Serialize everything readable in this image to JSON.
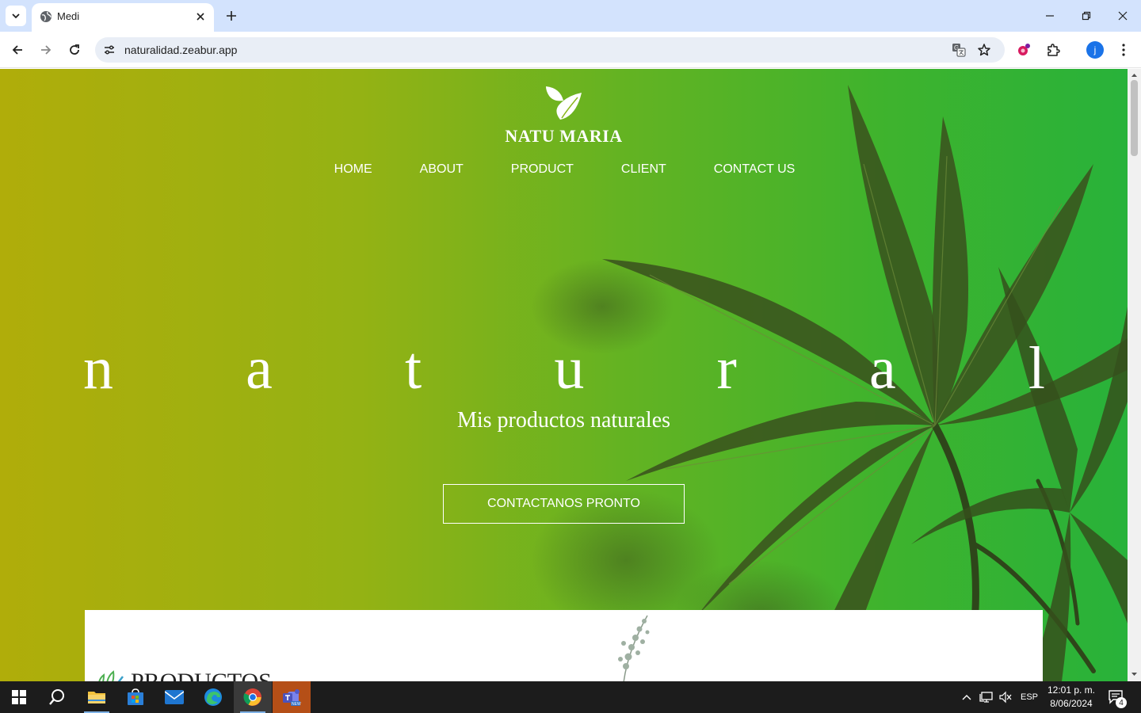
{
  "browser": {
    "tab_title": "Medi",
    "url": "naturalidad.zeabur.app",
    "profile_initial": "j"
  },
  "site": {
    "brand": "NATU MARIA",
    "nav": [
      "HOME",
      "ABOUT",
      "PRODUCT",
      "CLIENT",
      "CONTACT US"
    ],
    "hero_letters": [
      "n",
      "a",
      "t",
      "u",
      "r",
      "a",
      "l"
    ],
    "subtitle": "Mis productos naturales",
    "cta": "CONTACTANOS PRONTO",
    "section_title": "PRODUCTOS"
  },
  "taskbar": {
    "language": "ESP",
    "time": "12:01 p. m.",
    "date": "8/06/2024",
    "notifications": "4"
  },
  "colors": {
    "tabbar": "#d3e3fd",
    "hero_left": "#b0ad0a",
    "hero_right": "#28b23a",
    "leaf_dark": "#2f4a1a",
    "taskbar": "#1c1c1c"
  }
}
